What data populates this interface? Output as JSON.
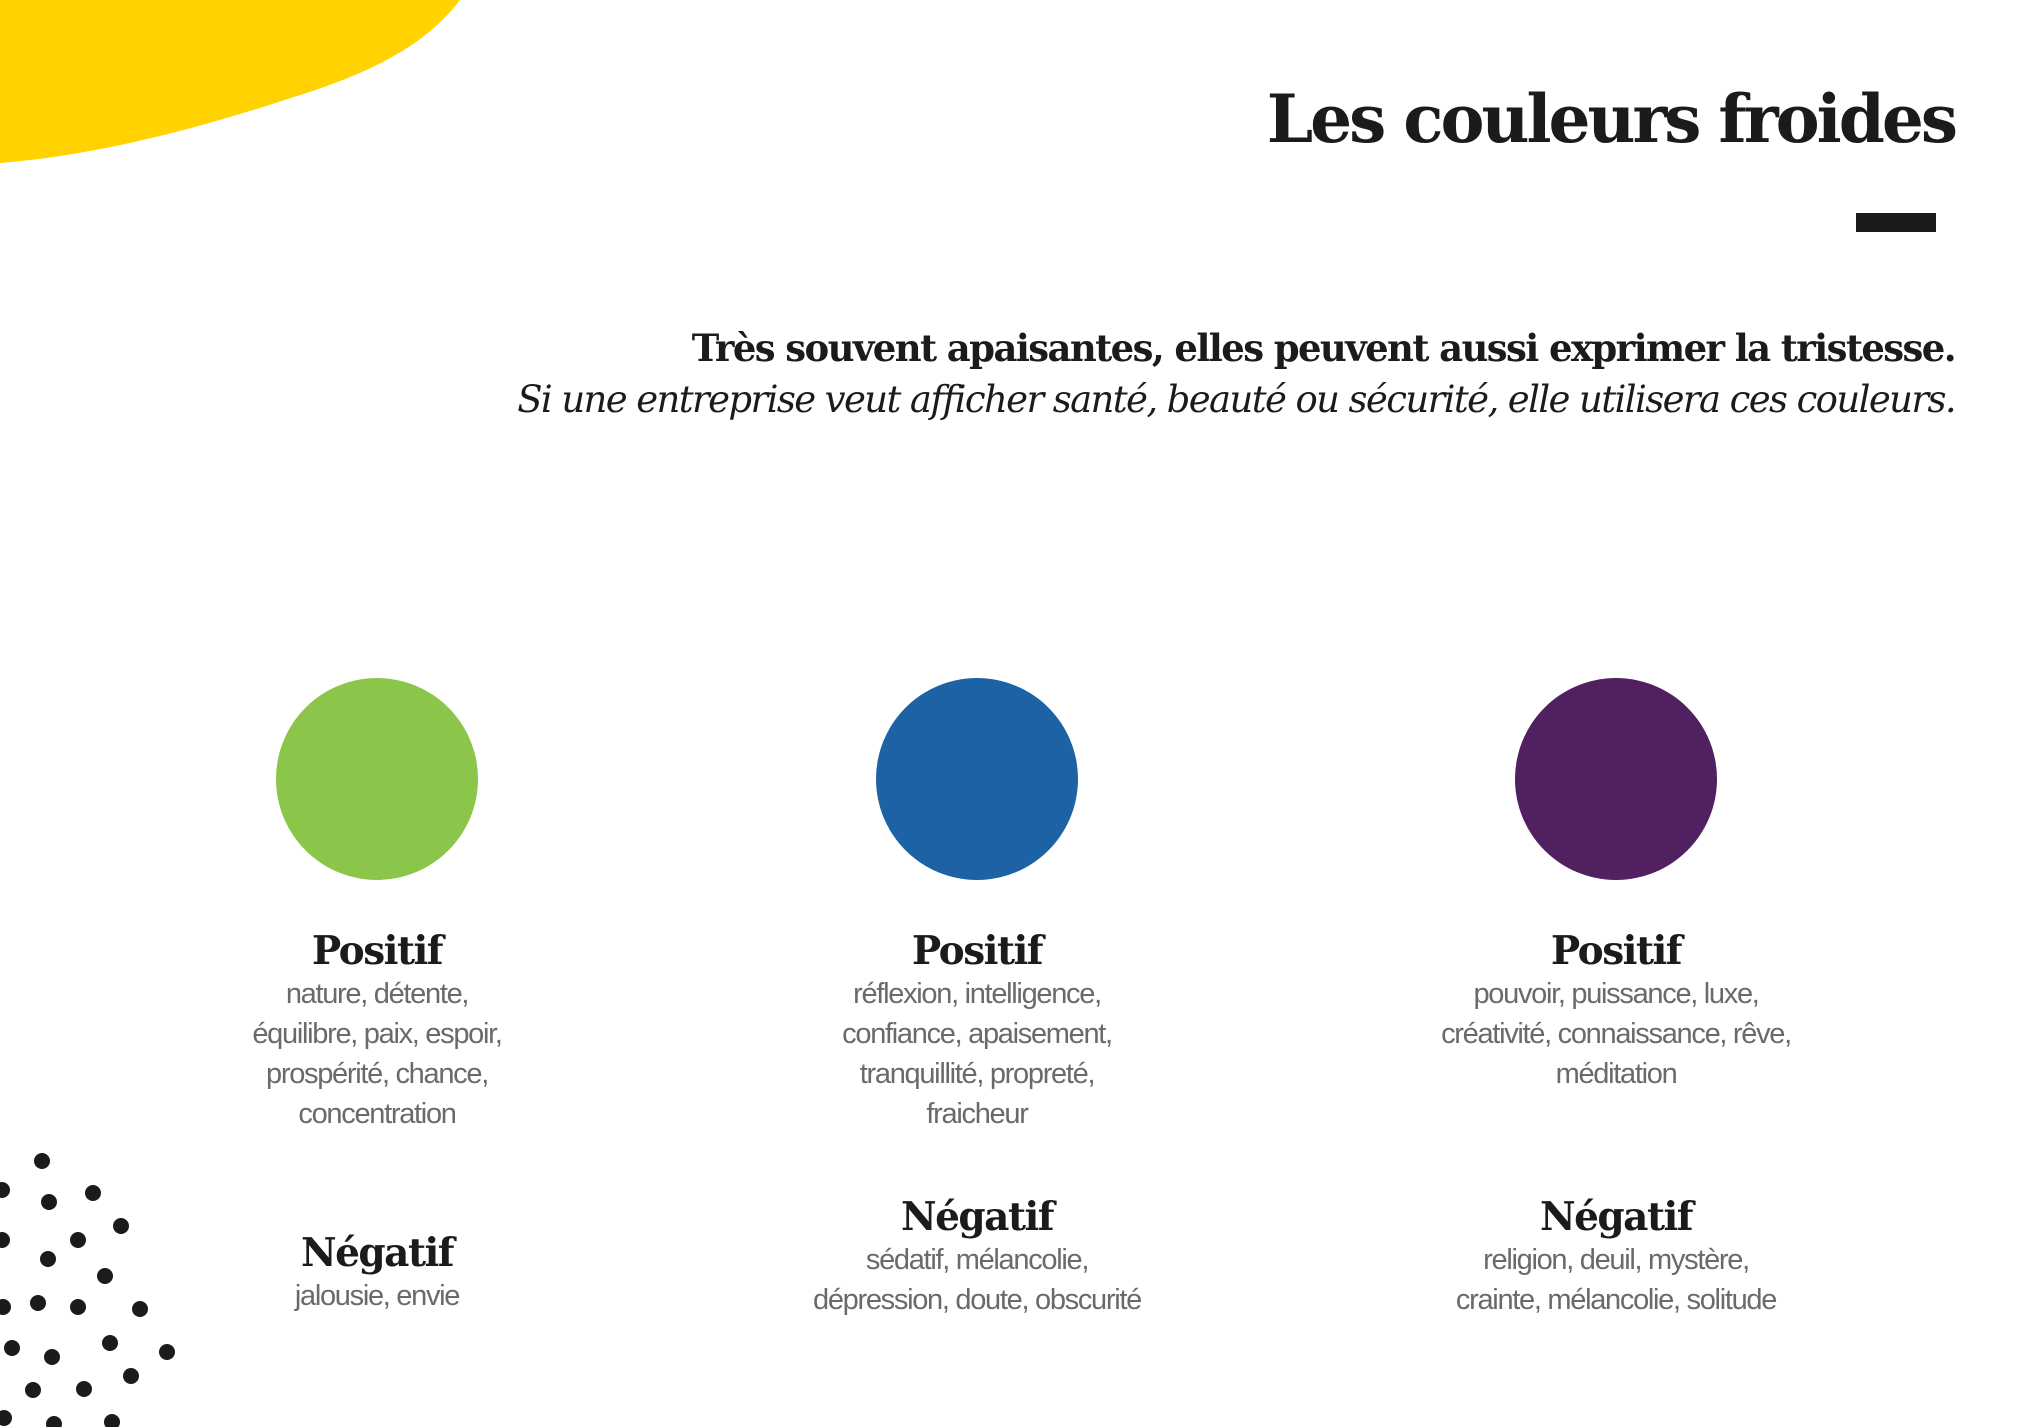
{
  "page": {
    "title": "Les couleurs froides",
    "intro_lead": "Très souvent apaisantes, elles peuvent aussi exprimer la tristesse.",
    "intro_sub": "Si une entreprise veut afficher santé, beauté ou sécurité, elle utilisera ces couleurs."
  },
  "colors": {
    "accent_yellow": "#ffd200",
    "text_dark": "#1a1c1c",
    "text_gray": "#6a6a6a"
  },
  "columns": [
    {
      "swatch_color": "#8bc64a",
      "positive_heading": "Positif",
      "positive_lines": [
        "nature, détente,",
        "équilibre, paix, espoir,",
        "prospérité, chance,",
        "concentration"
      ],
      "negative_heading": "Négatif",
      "negative_lines": [
        "jalousie, envie"
      ]
    },
    {
      "swatch_color": "#1c62a5",
      "positive_heading": "Positif",
      "positive_lines": [
        "réflexion, intelligence,",
        "confiance, apaisement,",
        "tranquillité, propreté,",
        "fraicheur"
      ],
      "negative_heading": "Négatif",
      "negative_lines": [
        "sédatif, mélancolie,",
        "dépression, doute, obscurité"
      ]
    },
    {
      "swatch_color": "#512060",
      "positive_heading": "Positif",
      "positive_lines": [
        "pouvoir, puissance, luxe,",
        "créativité, connaissance, rêve,",
        "méditation"
      ],
      "negative_heading": "Négatif",
      "negative_lines": [
        "religion, deuil, mystère,",
        "crainte, mélancolie, solitude"
      ]
    }
  ]
}
